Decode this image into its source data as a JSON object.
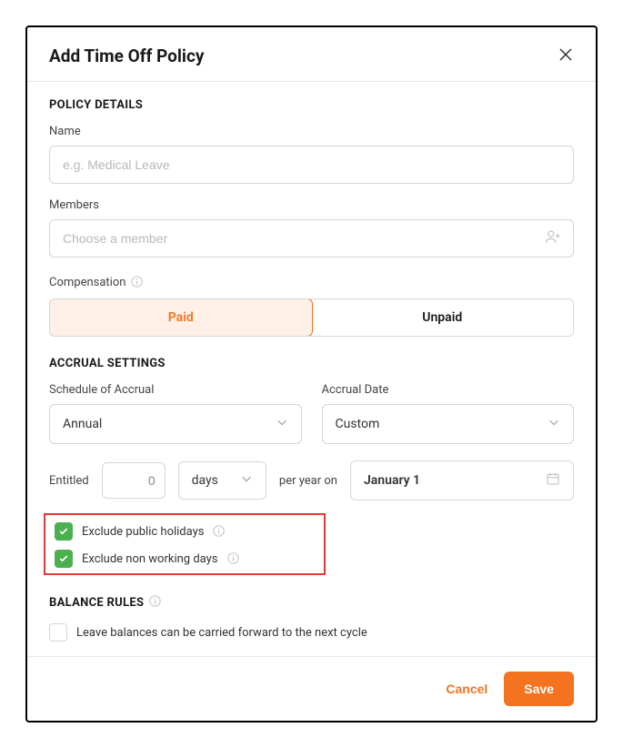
{
  "header": {
    "title": "Add Time Off Policy"
  },
  "policy_details": {
    "section_title": "POLICY DETAILS",
    "name_label": "Name",
    "name_placeholder": "e.g. Medical Leave",
    "members_label": "Members",
    "members_placeholder": "Choose a member",
    "compensation_label": "Compensation",
    "paid_label": "Paid",
    "unpaid_label": "Unpaid"
  },
  "accrual": {
    "section_title": "ACCRUAL SETTINGS",
    "schedule_label": "Schedule of Accrual",
    "schedule_value": "Annual",
    "accrual_date_label": "Accrual Date",
    "accrual_date_value": "Custom",
    "entitled_label": "Entitled",
    "entitled_value": "0",
    "unit_value": "days",
    "per_year_label": "per year on",
    "date_value": "January 1",
    "exclude_holidays_label": "Exclude public holidays",
    "exclude_nonworking_label": "Exclude non working days"
  },
  "balance": {
    "section_title": "BALANCE RULES",
    "carry_forward_label": "Leave balances can be carried forward to the next cycle"
  },
  "footer": {
    "cancel_label": "Cancel",
    "save_label": "Save"
  }
}
